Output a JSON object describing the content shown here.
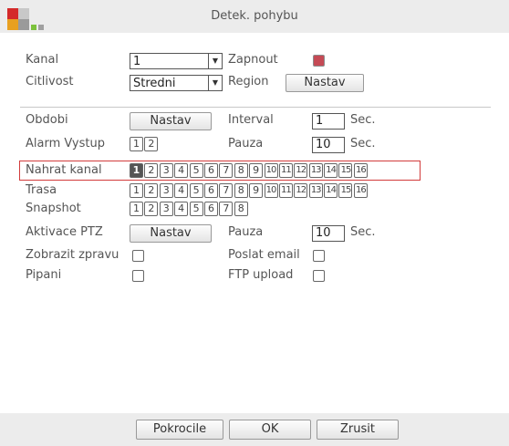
{
  "window": {
    "title": "Detek. pohybu"
  },
  "colors": {
    "accent": "#d23b3b",
    "checked": "#c54a55"
  },
  "row_kanal": {
    "label": "Kanal",
    "value": "1",
    "enable_label": "Zapnout",
    "enable_checked": true
  },
  "row_citlivost": {
    "label": "Citlivost",
    "value": "Stredni",
    "region_label": "Region",
    "region_button": "Nastav"
  },
  "row_obdobi": {
    "label": "Obdobi",
    "button": "Nastav",
    "interval_label": "Interval",
    "interval_value": "1",
    "interval_unit": "Sec."
  },
  "row_alarm": {
    "label": "Alarm Vystup",
    "channels": [
      "1",
      "2"
    ],
    "pauza_label": "Pauza",
    "pauza_value": "10",
    "pauza_unit": "Sec."
  },
  "row_nahrat": {
    "label": "Nahrat kanal",
    "channels": [
      "1",
      "2",
      "3",
      "4",
      "5",
      "6",
      "7",
      "8",
      "9",
      "10",
      "11",
      "12",
      "13",
      "14",
      "15",
      "16"
    ],
    "selected": "1"
  },
  "row_trasa": {
    "label": "Trasa",
    "channels": [
      "1",
      "2",
      "3",
      "4",
      "5",
      "6",
      "7",
      "8",
      "9",
      "10",
      "11",
      "12",
      "13",
      "14",
      "15",
      "16"
    ]
  },
  "row_snapshot": {
    "label": "Snapshot",
    "channels": [
      "1",
      "2",
      "3",
      "4",
      "5",
      "6",
      "7",
      "8"
    ]
  },
  "row_ptz": {
    "label": "Aktivace PTZ",
    "button": "Nastav",
    "pauza_label": "Pauza",
    "pauza_value": "10",
    "pauza_unit": "Sec."
  },
  "row_zprava": {
    "label": "Zobrazit zpravu",
    "email_label": "Poslat email"
  },
  "row_pipani": {
    "label": "Pipani",
    "ftp_label": "FTP upload"
  },
  "footer": {
    "advanced": "Pokrocile",
    "ok": "OK",
    "cancel": "Zrusit"
  }
}
